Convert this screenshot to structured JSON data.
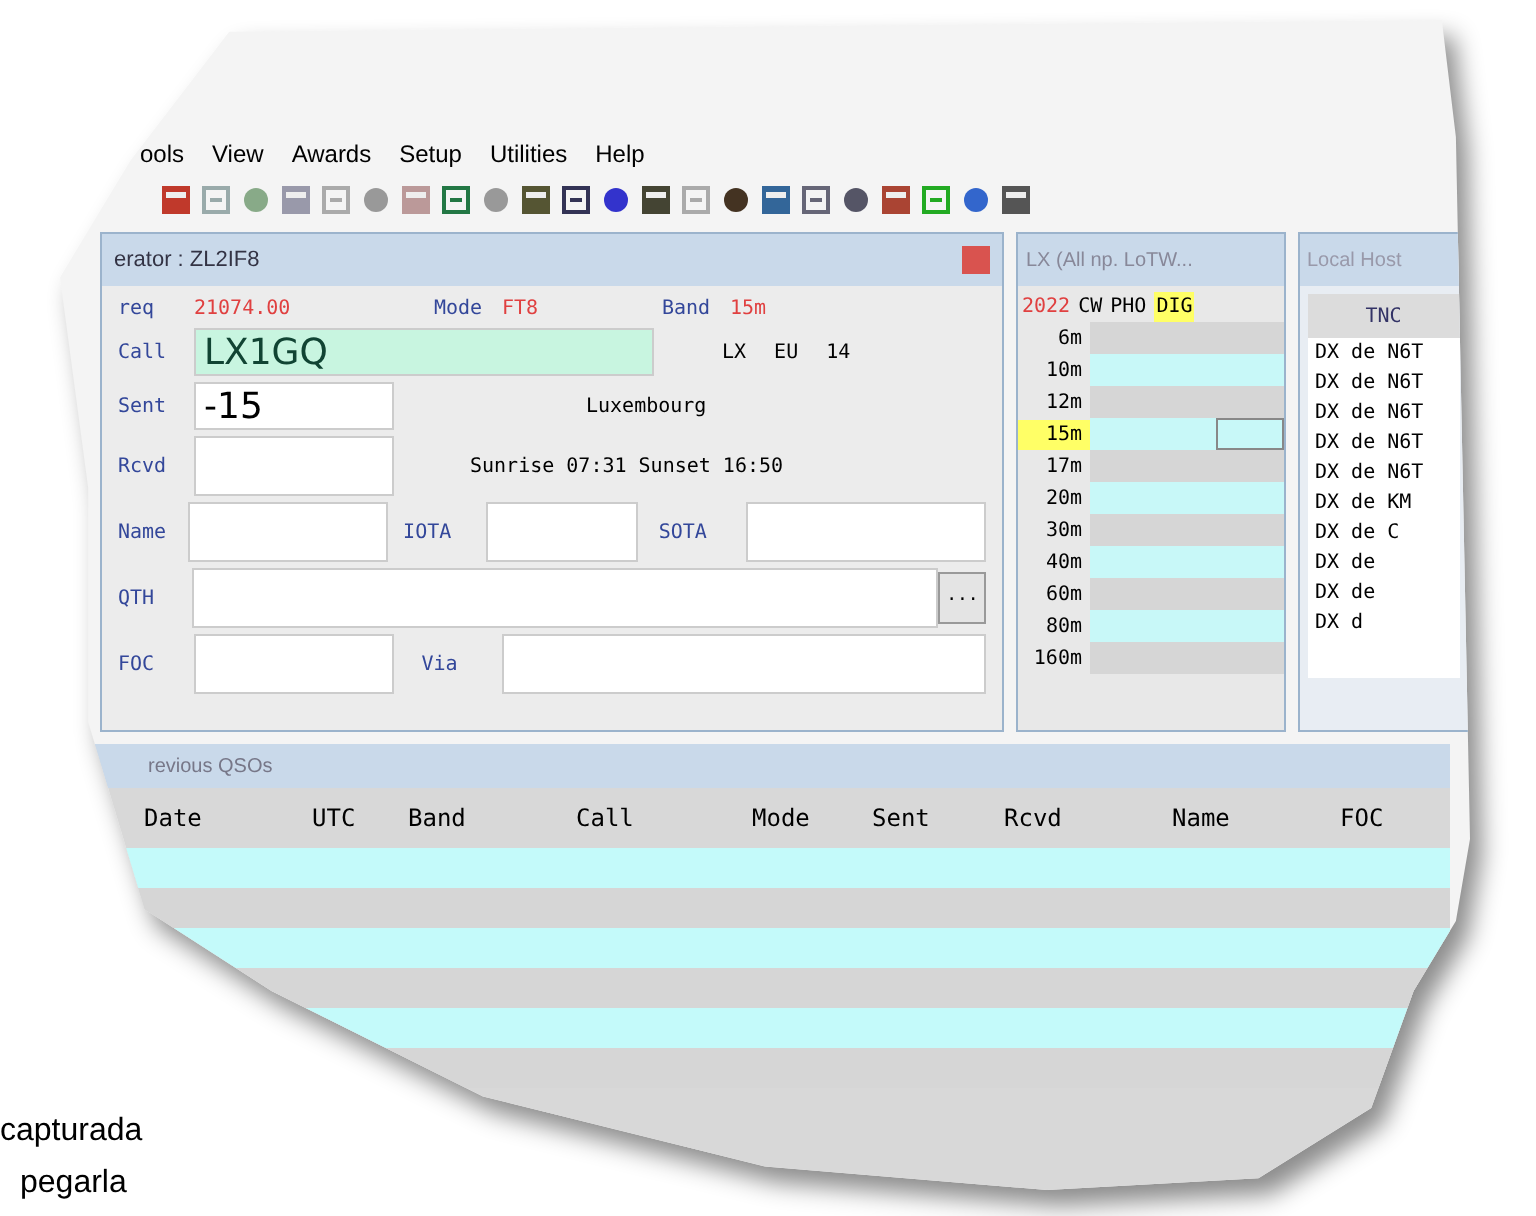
{
  "menu": [
    "ools",
    "View",
    "Awards",
    "Setup",
    "Utilities",
    "Help"
  ],
  "entry_window": {
    "title": "erator : ZL2IF8",
    "freq": {
      "label": "req",
      "value": "21074.00"
    },
    "mode": {
      "label": "Mode",
      "value": "FT8"
    },
    "band": {
      "label": "Band",
      "value": "15m"
    },
    "call": {
      "label": "Call",
      "value": "LX1GQ"
    },
    "prefix": "LX",
    "continent": "EU",
    "zone": "14",
    "sent": {
      "label": "Sent",
      "value": "-15"
    },
    "country": "Luxembourg",
    "rcvd": {
      "label": "Rcvd"
    },
    "sun_times": "Sunrise 07:31 Sunset 16:50",
    "name": {
      "label": "Name"
    },
    "iota": {
      "label": "IOTA"
    },
    "sota": {
      "label": "SOTA"
    },
    "qth": {
      "label": "QTH"
    },
    "qth_button": "...",
    "foc": {
      "label": "FOC"
    },
    "via": {
      "label": "Via"
    }
  },
  "band_panel": {
    "title": "LX (All np. LoTW...",
    "year": "2022",
    "modes": [
      {
        "label": "CW",
        "selected": false
      },
      {
        "label": "PHO",
        "selected": false
      },
      {
        "label": "DIG",
        "selected": true
      }
    ],
    "bands": [
      {
        "label": "6m",
        "selected": false
      },
      {
        "label": "10m",
        "selected": false
      },
      {
        "label": "12m",
        "selected": false
      },
      {
        "label": "15m",
        "selected": true
      },
      {
        "label": "17m",
        "selected": false
      },
      {
        "label": "20m",
        "selected": false
      },
      {
        "label": "30m",
        "selected": false
      },
      {
        "label": "40m",
        "selected": false
      },
      {
        "label": "60m",
        "selected": false
      },
      {
        "label": "80m",
        "selected": false
      },
      {
        "label": "160m",
        "selected": false
      }
    ]
  },
  "local_panel": {
    "title": "Local Host",
    "column": "TNC",
    "spots": [
      "DX de N6T",
      "DX de N6T",
      "DX de N6T",
      "DX de N6T",
      "DX de N6T",
      "DX de KM",
      "DX de C",
      "DX de",
      "DX de",
      "DX d"
    ]
  },
  "previous_qsos": {
    "title": "revious QSOs",
    "columns": [
      "Date",
      "UTC",
      "Band",
      "Call",
      "Mode",
      "Sent",
      "Rcvd",
      "Name",
      "FOC"
    ]
  },
  "page_text": [
    "capturada",
    "pegarla"
  ]
}
